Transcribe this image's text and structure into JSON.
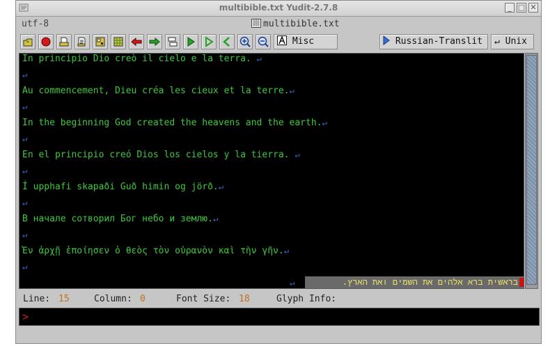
{
  "window": {
    "title": "multibible.txt  Yudit-2.7.8",
    "buttons": [
      "_",
      "□",
      "✕"
    ]
  },
  "info": {
    "encoding": "utf-8",
    "filename": "multibible.txt"
  },
  "toolbar": {
    "misc_label": "Misc",
    "input_label": "Russian-Translit",
    "linebreak_label": "↵ Unix",
    "icons": [
      "open-icon",
      "record-icon",
      "print-icon",
      "print-preview-icon",
      "find-icon",
      "goto-icon",
      "undo-icon",
      "redo-icon",
      "embed-icon",
      "direction-ltr-icon",
      "direction-rtl-icon",
      "direction-back-icon",
      "zoom-in-icon",
      "zoom-out-icon"
    ]
  },
  "editor": {
    "lines": [
      "In principio Dio creò il cielo e la terra. ",
      "",
      "Au commencement, Dieu créa les cieux et la terre.",
      "",
      "In the beginning God created the heavens and the earth.",
      "",
      "En el principio creó Dios los cielos y la tierra. ",
      "",
      "Í upphafi skapaði Guð himin og jörð.",
      "",
      "В начале сотворил Бог небо и землю.",
      "",
      "Ἐν ἀρχῇ ἐποίησεν ὁ θεὸς τὸν οὐρανὸν καὶ τὴν γῆν.",
      ""
    ],
    "newline_glyph": "↵",
    "hebrew_line": "בראשית ברא אלהים את השמים ואת הארץ."
  },
  "status": {
    "line_label": "Line:",
    "line_value": "15",
    "column_label": "Column:",
    "column_value": "0",
    "fontsize_label": "Font Size:",
    "fontsize_value": "18",
    "glyph_label": "Glyph Info:"
  },
  "command": {
    "prompt": ">"
  }
}
